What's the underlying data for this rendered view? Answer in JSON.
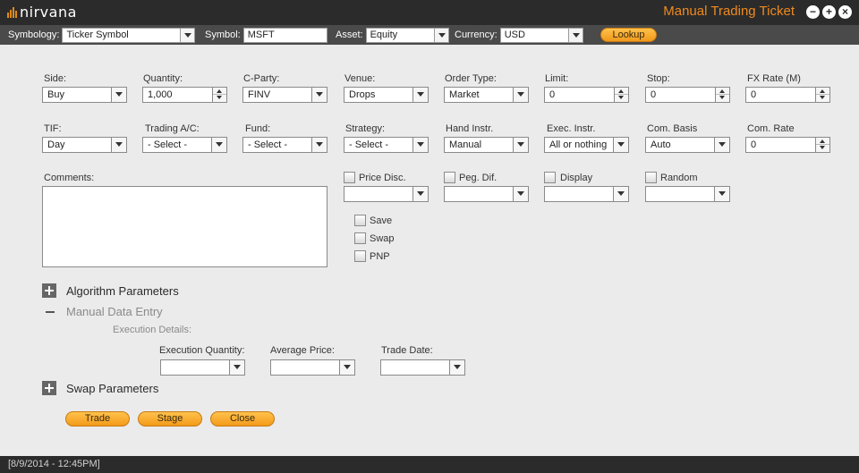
{
  "app": {
    "logo": "nirvana",
    "title": "Manual Trading Ticket"
  },
  "window_controls": {
    "minimize": "−",
    "maximize": "+",
    "close": "×"
  },
  "toolbar": {
    "symbology_label": "Symbology:",
    "symbology_value": "Ticker Symbol",
    "symbol_label": "Symbol:",
    "symbol_value": "MSFT",
    "asset_label": "Asset:",
    "asset_value": "Equity",
    "currency_label": "Currency:",
    "currency_value": "USD",
    "lookup_label": "Lookup"
  },
  "row1": [
    {
      "label": "Side:",
      "value": "Buy"
    },
    {
      "label": "Quantity:",
      "value": "1,000"
    },
    {
      "label": "C-Party:",
      "value": "FINV"
    },
    {
      "label": "Venue:",
      "value": "Drops"
    },
    {
      "label": "Order Type:",
      "value": "Market"
    },
    {
      "label": "Limit:",
      "value": "0"
    },
    {
      "label": "Stop:",
      "value": "0"
    },
    {
      "label": "FX Rate (M)",
      "value": "0"
    }
  ],
  "row2": [
    {
      "label": "TIF:",
      "value": "Day"
    },
    {
      "label": "Trading A/C:",
      "value": "- Select -"
    },
    {
      "label": "Fund:",
      "value": "- Select -"
    },
    {
      "label": "Strategy:",
      "value": "- Select -"
    },
    {
      "label": "Hand Instr.",
      "value": "Manual"
    },
    {
      "label": "Exec. Instr.",
      "value": "All or nothing"
    },
    {
      "label": "Com. Basis",
      "value": "Auto"
    },
    {
      "label": "Com. Rate",
      "value": "0"
    }
  ],
  "comments_label": "Comments:",
  "options": [
    {
      "label": "Price Disc.",
      "value": ""
    },
    {
      "label": "Peg. Dif.",
      "value": ""
    },
    {
      "label": "Display",
      "value": ""
    },
    {
      "label": "Random",
      "value": ""
    }
  ],
  "checks": {
    "save": "Save",
    "swap": "Swap",
    "pnp": "PNP"
  },
  "sections": {
    "algorithm": "Algorithm Parameters",
    "manual": "Manual Data Entry",
    "execution_details": "Execution Details:",
    "swap": "Swap Parameters"
  },
  "manual_fields": [
    {
      "label": "Execution Quantity:",
      "value": ""
    },
    {
      "label": "Average Price:",
      "value": ""
    },
    {
      "label": "Trade Date:",
      "value": ""
    }
  ],
  "buttons": {
    "trade": "Trade",
    "stage": "Stage",
    "close": "Close"
  },
  "status": "[8/9/2014 - 12:45PM]",
  "colors": {
    "accent": "#f08a1e",
    "titlebar": "#2b2b2b",
    "toolbar": "#4a4a4a",
    "panel": "#ebebeb"
  }
}
